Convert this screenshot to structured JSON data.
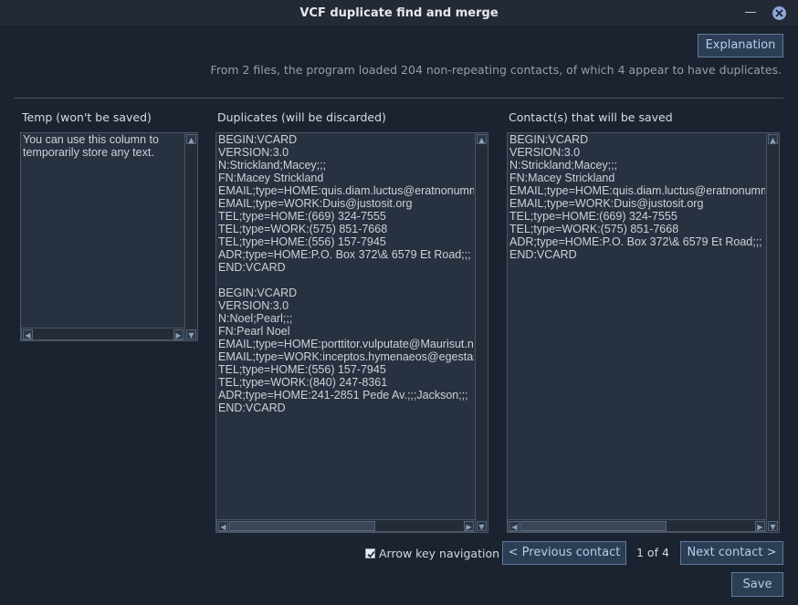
{
  "window": {
    "title": "VCF duplicate find and merge"
  },
  "header": {
    "explanation_label": "Explanation",
    "info_text": "From 2 files, the program loaded 204 non-repeating contacts, of which 4 appear to have duplicates."
  },
  "columns": {
    "temp": {
      "label": "Temp (won't be saved)",
      "text": "You can use this column to temporarily store any text."
    },
    "duplicates": {
      "label": "Duplicates (will be discarded)",
      "text": "BEGIN:VCARD\nVERSION:3.0\nN:Strickland;Macey;;;\nFN:Macey Strickland\nEMAIL;type=HOME:quis.diam.luctus@eratnonummy.com\nEMAIL;type=WORK:Duis@justosit.org\nTEL;type=HOME:(669) 324-7555\nTEL;type=WORK:(575) 851-7668\nTEL;type=HOME:(556) 157-7945\nADR;type=HOME:P.O. Box 372\\& 6579 Et Road;;;\nEND:VCARD\n\nBEGIN:VCARD\nVERSION:3.0\nN:Noel;Pearl;;;\nFN:Pearl Noel\nEMAIL;type=HOME:porttitor.vulputate@Maurisut.net\nEMAIL;type=WORK:inceptos.hymenaeos@egestas.com\nTEL;type=HOME:(556) 157-7945\nTEL;type=WORK:(840) 247-8361\nADR;type=HOME:241-2851 Pede Av.;;;Jackson;;;\nEND:VCARD"
    },
    "saved": {
      "label": "Contact(s) that will be saved",
      "text": "BEGIN:VCARD\nVERSION:3.0\nN:Strickland;Macey;;;\nFN:Macey Strickland\nEMAIL;type=HOME:quis.diam.luctus@eratnonummy.com\nEMAIL;type=WORK:Duis@justosit.org\nTEL;type=HOME:(669) 324-7555\nTEL;type=WORK:(575) 851-7668\nADR;type=HOME:P.O. Box 372\\& 6579 Et Road;;;\nEND:VCARD"
    }
  },
  "footer": {
    "arrow_nav_label": "Arrow key navigation",
    "arrow_nav_checked": true,
    "prev_label": "< Previous contact",
    "pager_text": "1 of 4",
    "next_label": "Next contact >",
    "save_label": "Save"
  },
  "icons": {
    "minimize": "minimize-icon",
    "close": "close-icon",
    "scroll_up": "chevron-up-icon",
    "scroll_down": "chevron-down-icon",
    "scroll_left": "chevron-left-icon",
    "scroll_right": "chevron-right-icon",
    "check": "check-icon"
  },
  "colors": {
    "background": "#1b2330",
    "panel": "#283140",
    "button": "#2c3e56",
    "button_text": "#b9cbe6",
    "close_button": "#8fa6d8"
  }
}
